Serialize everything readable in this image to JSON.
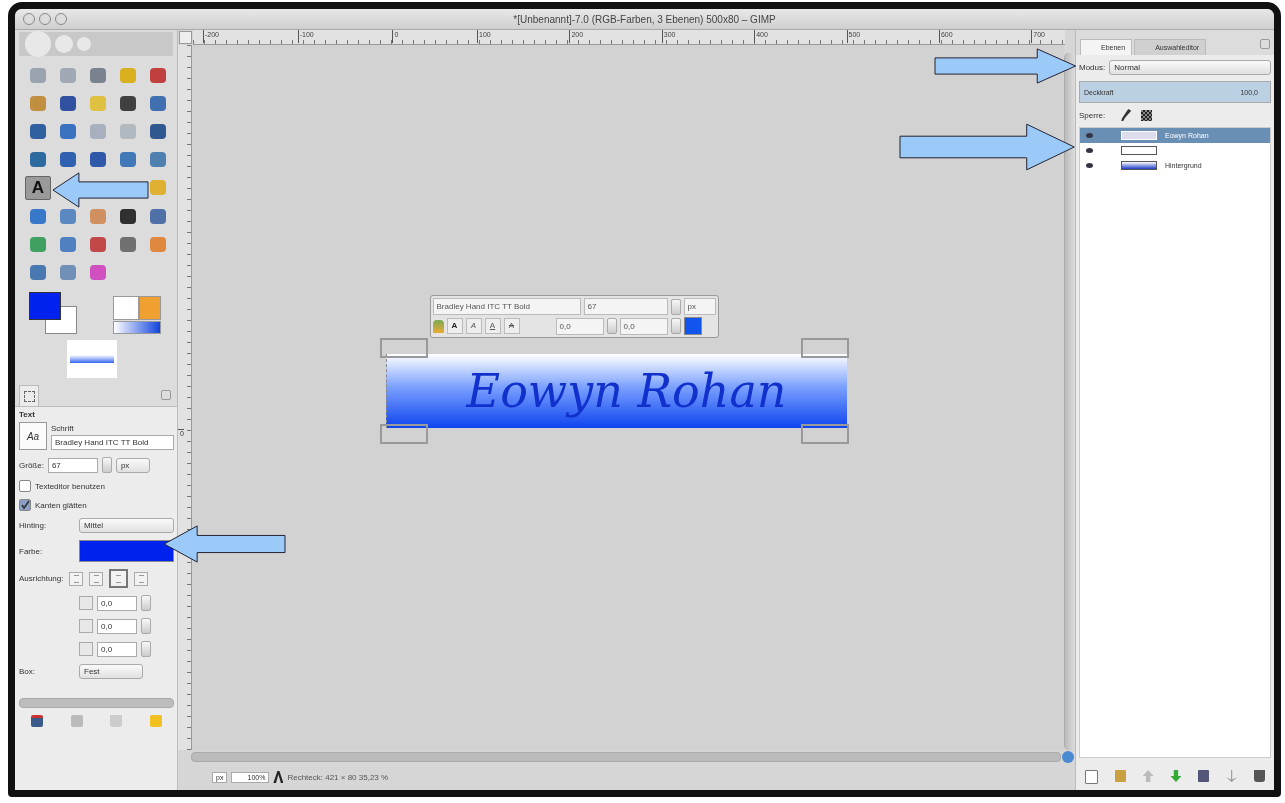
{
  "window": {
    "title": "*[Unbenannt]-7.0 (RGB-Farben, 3 Ebenen) 500x80 – GIMP"
  },
  "toolbox": {
    "tools": [
      {
        "kind": "shape",
        "color": "#9aa4b0",
        "selected": false
      },
      {
        "kind": "shape",
        "color": "#a0a8b4",
        "selected": false
      },
      {
        "kind": "shape",
        "color": "#7a8290",
        "selected": false
      },
      {
        "kind": "shape",
        "color": "#d8b020",
        "selected": false
      },
      {
        "kind": "shape",
        "color": "#c04040",
        "selected": false
      },
      {
        "kind": "shape",
        "color": "#c09040",
        "selected": false
      },
      {
        "kind": "shape",
        "color": "#3050a0",
        "selected": false
      },
      {
        "kind": "shape",
        "color": "#e0c040",
        "selected": false
      },
      {
        "kind": "shape",
        "color": "#404040",
        "selected": false
      },
      {
        "kind": "shape",
        "color": "#4070b0",
        "selected": false
      },
      {
        "kind": "shape",
        "color": "#3060a0",
        "selected": false
      },
      {
        "kind": "shape",
        "color": "#3a70c0",
        "selected": false
      },
      {
        "kind": "shape",
        "color": "#a8b0c0",
        "selected": false
      },
      {
        "kind": "shape",
        "color": "#b0b8c0",
        "selected": false
      },
      {
        "kind": "shape",
        "color": "#305890",
        "selected": false
      },
      {
        "kind": "shape",
        "color": "#2d6aa0",
        "selected": false
      },
      {
        "kind": "shape",
        "color": "#3060b0",
        "selected": false
      },
      {
        "kind": "shape",
        "color": "#3058a8",
        "selected": false
      },
      {
        "kind": "shape",
        "color": "#4078b8",
        "selected": false
      },
      {
        "kind": "shape",
        "color": "#5080b0",
        "selected": false
      },
      {
        "kind": "glyph",
        "label": "A",
        "selected": true
      },
      {
        "kind": "shape",
        "color": "#e0b030",
        "selected": false
      },
      {
        "kind": "shape",
        "color": "#3878c8",
        "selected": false
      },
      {
        "kind": "shape",
        "color": "#5a88c0",
        "selected": false
      },
      {
        "kind": "shape",
        "color": "#d09060",
        "selected": false
      },
      {
        "kind": "shape",
        "color": "#303030",
        "selected": false
      },
      {
        "kind": "shape",
        "color": "#5070a8",
        "selected": false
      },
      {
        "kind": "shape",
        "color": "#40a060",
        "selected": false
      },
      {
        "kind": "shape",
        "color": "#5080c0",
        "selected": false
      },
      {
        "kind": "shape",
        "color": "#c04848",
        "selected": false
      },
      {
        "kind": "shape",
        "color": "#707070",
        "selected": false
      },
      {
        "kind": "shape",
        "color": "#e08840",
        "selected": false
      },
      {
        "kind": "shape",
        "color": "#4a78b0",
        "selected": false
      },
      {
        "kind": "shape",
        "color": "#7090b8",
        "selected": false
      },
      {
        "kind": "shape",
        "color": "#d050c0",
        "selected": false
      }
    ]
  },
  "tool_options": {
    "title": "Text",
    "font_label": "Schrift",
    "font_preview": "Aa",
    "font": "Bradley Hand ITC TT Bold",
    "size_label": "Größe:",
    "size": "67",
    "unit": "px",
    "checkboxes": [
      {
        "label": "Texteditor benutzen",
        "checked": false
      },
      {
        "label": "Kanten glätten",
        "checked": true
      }
    ],
    "hinting_label": "Hinting:",
    "hinting": "Mittel",
    "color_label": "Farbe:",
    "justify_label": "Ausrichtung:",
    "justify": [
      {
        "selected": false
      },
      {
        "selected": false
      },
      {
        "selected": true
      },
      {
        "selected": false
      }
    ],
    "offsets": [
      "0,0",
      "0,0",
      "0,0"
    ],
    "box_label": "Box:",
    "box": "Fest"
  },
  "canvas": {
    "ruler_labels": [
      "-200",
      "-100",
      "0",
      "100",
      "200",
      "300",
      "400",
      "500",
      "600",
      "700"
    ],
    "vertical_ruler_labels": [
      "0"
    ],
    "text_toolbar": {
      "font": "Bradley Hand ITC TT Bold",
      "size": "67",
      "unit": "px",
      "styles": [
        {
          "label": "A",
          "kind": "bold"
        },
        {
          "label": "A",
          "kind": "italic"
        },
        {
          "label": "A",
          "kind": "underline"
        },
        {
          "label": "A",
          "kind": "strike"
        }
      ],
      "baseline": "0,0",
      "kerning": "0,0"
    },
    "image_text": "Eowyn Rohan"
  },
  "status_bar": {
    "unit": "px",
    "zoom": "100%",
    "message": "Rechteck: 421 × 80  35,23 %"
  },
  "layers_dock": {
    "tabs": [
      {
        "label": "Ebenen",
        "selected": true
      },
      {
        "label": "Auswahleditor",
        "selected": false
      }
    ],
    "mode_label": "Modus:",
    "mode": "Normal",
    "opacity_label": "Deckkraft",
    "opacity": "100,0",
    "level": 1,
    "lock_label": "Sperre:",
    "layers": [
      {
        "name": "Eowyn Rohan",
        "kind": "text",
        "visible": true,
        "selected": true
      },
      {
        "kind": "frame",
        "visible": true,
        "selected": false
      },
      {
        "name": "Hintergrund",
        "kind": "gradient",
        "visible": true,
        "selected": false
      }
    ]
  },
  "annotations": [
    {
      "kind": "right"
    },
    {
      "kind": "right"
    },
    {
      "kind": "left"
    },
    {
      "kind": "left"
    }
  ]
}
